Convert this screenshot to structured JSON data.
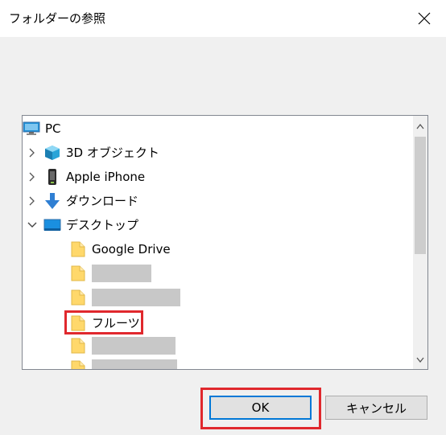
{
  "dialog": {
    "title": "フォルダーの参照",
    "description": ""
  },
  "tree": {
    "items": [
      {
        "label": "PC",
        "icon": "pc-icon",
        "expandable": false
      },
      {
        "label": "3D オブジェクト",
        "icon": "3d-objects-icon",
        "expandable": true,
        "expanded": false
      },
      {
        "label": "Apple iPhone",
        "icon": "phone-icon",
        "expandable": true,
        "expanded": false
      },
      {
        "label": "ダウンロード",
        "icon": "download-icon",
        "expandable": true,
        "expanded": false
      },
      {
        "label": "デスクトップ",
        "icon": "desktop-icon",
        "expandable": true,
        "expanded": true
      },
      {
        "label": "Google Drive",
        "icon": "folder-icon"
      },
      {
        "label": "",
        "icon": "folder-icon",
        "redacted": true
      },
      {
        "label": "",
        "icon": "folder-icon",
        "redacted": true
      },
      {
        "label": "フルーツ",
        "icon": "folder-icon",
        "highlighted": true
      },
      {
        "label": "",
        "icon": "folder-icon",
        "redacted": true
      },
      {
        "label": "",
        "icon": "folder-icon",
        "redacted": true
      }
    ]
  },
  "buttons": {
    "ok": "OK",
    "cancel": "キャンセル"
  },
  "colors": {
    "highlight": "#e0282d",
    "focus": "#0078d7",
    "folder": "#ffd86b"
  }
}
